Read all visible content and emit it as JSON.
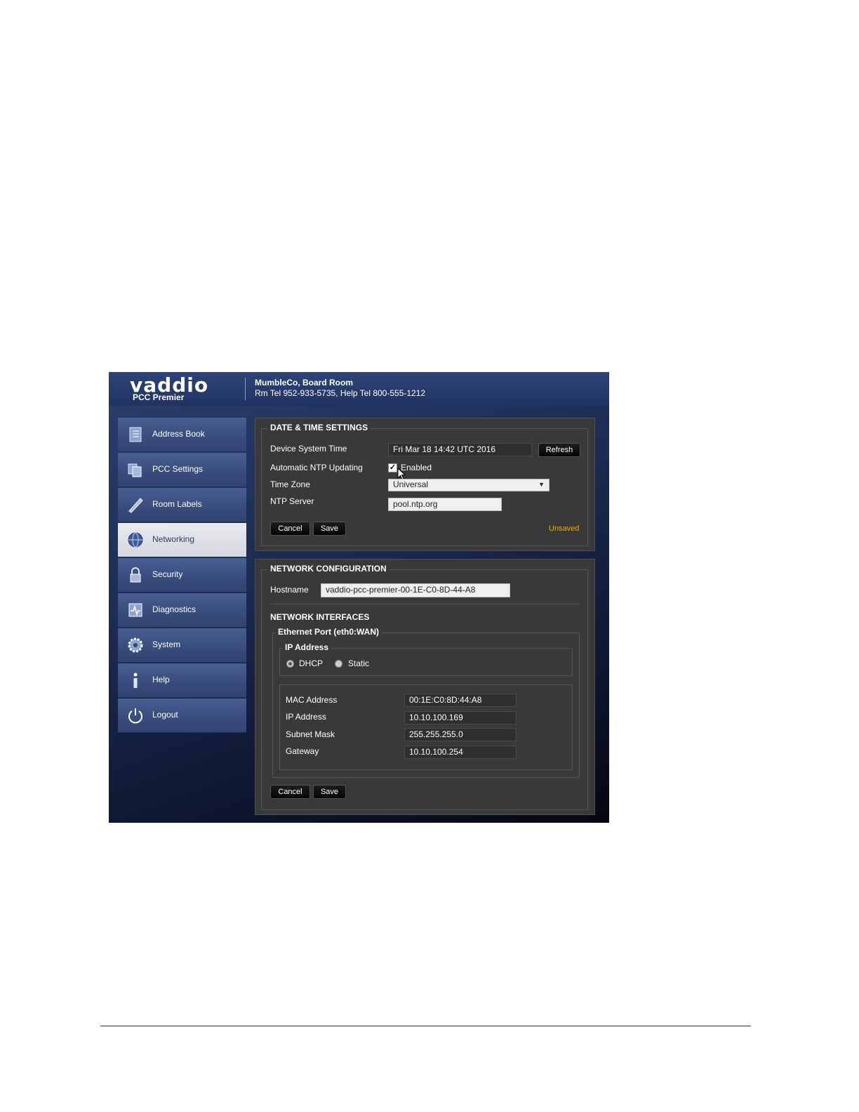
{
  "header": {
    "logo_text": "vaddio",
    "product": "PCC Premier",
    "room_name": "MumbleCo, Board Room",
    "phone_line": "Rm Tel 952-933-5735, Help Tel 800-555-1212"
  },
  "sidebar": {
    "items": [
      {
        "label": "Address Book",
        "icon": "address-book-icon"
      },
      {
        "label": "PCC Settings",
        "icon": "pcc-settings-icon"
      },
      {
        "label": "Room Labels",
        "icon": "room-labels-icon"
      },
      {
        "label": "Networking",
        "icon": "networking-icon",
        "active": true
      },
      {
        "label": "Security",
        "icon": "lock-icon"
      },
      {
        "label": "Diagnostics",
        "icon": "diagnostics-icon"
      },
      {
        "label": "System",
        "icon": "gear-icon"
      },
      {
        "label": "Help",
        "icon": "info-icon"
      },
      {
        "label": "Logout",
        "icon": "power-icon"
      }
    ]
  },
  "datetime": {
    "title": "DATE & TIME SETTINGS",
    "system_time_label": "Device System Time",
    "system_time_value": "Fri Mar 18 14:42 UTC 2016",
    "refresh_label": "Refresh",
    "ntp_label": "Automatic NTP Updating",
    "ntp_checkbox_label": "Enabled",
    "ntp_checked": true,
    "timezone_label": "Time Zone",
    "timezone_value": "Universal",
    "ntp_server_label": "NTP Server",
    "ntp_server_value": "pool.ntp.org",
    "cancel_label": "Cancel",
    "save_label": "Save",
    "status": "Unsaved",
    "status_color": "#e8b400"
  },
  "network": {
    "title": "NETWORK CONFIGURATION",
    "hostname_label": "Hostname",
    "hostname_value": "vaddio-pcc-premier-00-1E-C0-8D-44-A8",
    "interfaces_title": "NETWORK INTERFACES",
    "port_title": "Ethernet Port (eth0:WAN)",
    "ip_group_title": "IP Address",
    "dhcp_label": "DHCP",
    "static_label": "Static",
    "mode": "DHCP",
    "mac_label": "MAC Address",
    "mac_value": "00:1E:C0:8D:44:A8",
    "ip_label": "IP Address",
    "ip_value": "10.10.100.169",
    "subnet_label": "Subnet Mask",
    "subnet_value": "255.255.255.0",
    "gateway_label": "Gateway",
    "gateway_value": "10.10.100.254",
    "cancel_label": "Cancel",
    "save_label": "Save"
  }
}
